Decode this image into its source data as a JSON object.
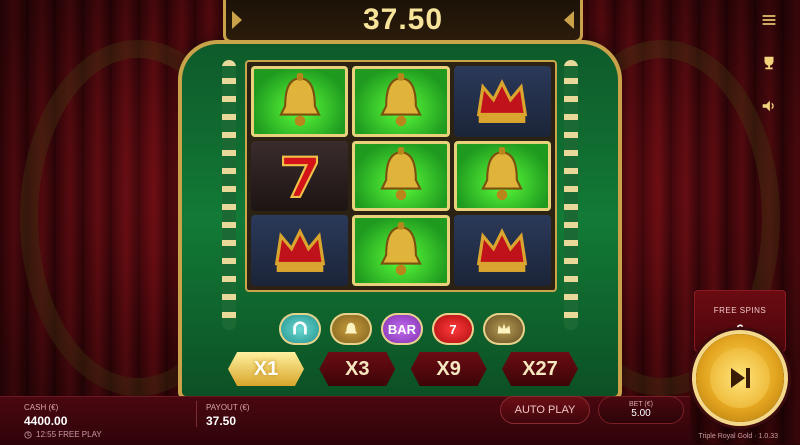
{
  "win": {
    "amount": "37.50"
  },
  "reels": [
    [
      "gold-bell",
      "bell",
      "crown"
    ],
    [
      "seven",
      "bell",
      "bell"
    ],
    [
      "crown",
      "bell",
      "crown"
    ]
  ],
  "paytable": {
    "symbols": [
      "horseshoe-icon",
      "bell-icon",
      "BAR",
      "7",
      "crown-icon"
    ]
  },
  "multipliers": {
    "items": [
      "X1",
      "X3",
      "X9",
      "X27"
    ],
    "active_index": 0
  },
  "free_spins": {
    "label": "FREE SPINS",
    "value": "6"
  },
  "bottom": {
    "cash_label": "CASH (€)",
    "cash_value": "4400.00",
    "payout_label": "PAYOUT (€)",
    "payout_value": "37.50",
    "auto_play": "AUTO PLAY",
    "bet_label": "BET (€)",
    "bet_value": "5.00",
    "status": "12:55 FREE PLAY",
    "game_name": "Triple Royal Gold · 1.0.33"
  },
  "colors": {
    "felt": "#127a36",
    "gold": "#c9a24a",
    "curtain": "#7a0f16",
    "win_text": "#f7e39a",
    "spin_button": "#e3a51f"
  }
}
